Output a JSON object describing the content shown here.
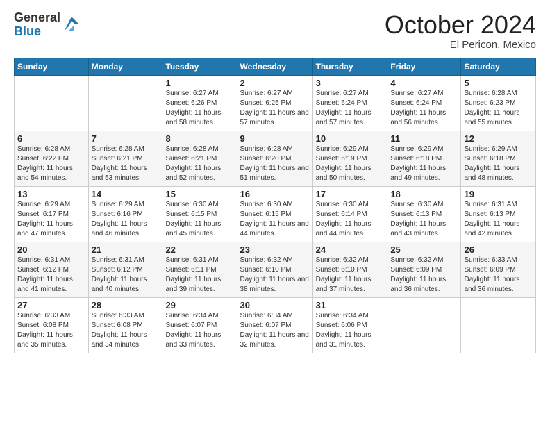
{
  "logo": {
    "general": "General",
    "blue": "Blue"
  },
  "header": {
    "month": "October 2024",
    "location": "El Pericon, Mexico"
  },
  "days_of_week": [
    "Sunday",
    "Monday",
    "Tuesday",
    "Wednesday",
    "Thursday",
    "Friday",
    "Saturday"
  ],
  "weeks": [
    [
      {
        "day": "",
        "info": ""
      },
      {
        "day": "",
        "info": ""
      },
      {
        "day": "1",
        "info": "Sunrise: 6:27 AM\nSunset: 6:26 PM\nDaylight: 11 hours and 58 minutes."
      },
      {
        "day": "2",
        "info": "Sunrise: 6:27 AM\nSunset: 6:25 PM\nDaylight: 11 hours and 57 minutes."
      },
      {
        "day": "3",
        "info": "Sunrise: 6:27 AM\nSunset: 6:24 PM\nDaylight: 11 hours and 57 minutes."
      },
      {
        "day": "4",
        "info": "Sunrise: 6:27 AM\nSunset: 6:24 PM\nDaylight: 11 hours and 56 minutes."
      },
      {
        "day": "5",
        "info": "Sunrise: 6:28 AM\nSunset: 6:23 PM\nDaylight: 11 hours and 55 minutes."
      }
    ],
    [
      {
        "day": "6",
        "info": "Sunrise: 6:28 AM\nSunset: 6:22 PM\nDaylight: 11 hours and 54 minutes."
      },
      {
        "day": "7",
        "info": "Sunrise: 6:28 AM\nSunset: 6:21 PM\nDaylight: 11 hours and 53 minutes."
      },
      {
        "day": "8",
        "info": "Sunrise: 6:28 AM\nSunset: 6:21 PM\nDaylight: 11 hours and 52 minutes."
      },
      {
        "day": "9",
        "info": "Sunrise: 6:28 AM\nSunset: 6:20 PM\nDaylight: 11 hours and 51 minutes."
      },
      {
        "day": "10",
        "info": "Sunrise: 6:29 AM\nSunset: 6:19 PM\nDaylight: 11 hours and 50 minutes."
      },
      {
        "day": "11",
        "info": "Sunrise: 6:29 AM\nSunset: 6:18 PM\nDaylight: 11 hours and 49 minutes."
      },
      {
        "day": "12",
        "info": "Sunrise: 6:29 AM\nSunset: 6:18 PM\nDaylight: 11 hours and 48 minutes."
      }
    ],
    [
      {
        "day": "13",
        "info": "Sunrise: 6:29 AM\nSunset: 6:17 PM\nDaylight: 11 hours and 47 minutes."
      },
      {
        "day": "14",
        "info": "Sunrise: 6:29 AM\nSunset: 6:16 PM\nDaylight: 11 hours and 46 minutes."
      },
      {
        "day": "15",
        "info": "Sunrise: 6:30 AM\nSunset: 6:15 PM\nDaylight: 11 hours and 45 minutes."
      },
      {
        "day": "16",
        "info": "Sunrise: 6:30 AM\nSunset: 6:15 PM\nDaylight: 11 hours and 44 minutes."
      },
      {
        "day": "17",
        "info": "Sunrise: 6:30 AM\nSunset: 6:14 PM\nDaylight: 11 hours and 44 minutes."
      },
      {
        "day": "18",
        "info": "Sunrise: 6:30 AM\nSunset: 6:13 PM\nDaylight: 11 hours and 43 minutes."
      },
      {
        "day": "19",
        "info": "Sunrise: 6:31 AM\nSunset: 6:13 PM\nDaylight: 11 hours and 42 minutes."
      }
    ],
    [
      {
        "day": "20",
        "info": "Sunrise: 6:31 AM\nSunset: 6:12 PM\nDaylight: 11 hours and 41 minutes."
      },
      {
        "day": "21",
        "info": "Sunrise: 6:31 AM\nSunset: 6:12 PM\nDaylight: 11 hours and 40 minutes."
      },
      {
        "day": "22",
        "info": "Sunrise: 6:31 AM\nSunset: 6:11 PM\nDaylight: 11 hours and 39 minutes."
      },
      {
        "day": "23",
        "info": "Sunrise: 6:32 AM\nSunset: 6:10 PM\nDaylight: 11 hours and 38 minutes."
      },
      {
        "day": "24",
        "info": "Sunrise: 6:32 AM\nSunset: 6:10 PM\nDaylight: 11 hours and 37 minutes."
      },
      {
        "day": "25",
        "info": "Sunrise: 6:32 AM\nSunset: 6:09 PM\nDaylight: 11 hours and 36 minutes."
      },
      {
        "day": "26",
        "info": "Sunrise: 6:33 AM\nSunset: 6:09 PM\nDaylight: 11 hours and 36 minutes."
      }
    ],
    [
      {
        "day": "27",
        "info": "Sunrise: 6:33 AM\nSunset: 6:08 PM\nDaylight: 11 hours and 35 minutes."
      },
      {
        "day": "28",
        "info": "Sunrise: 6:33 AM\nSunset: 6:08 PM\nDaylight: 11 hours and 34 minutes."
      },
      {
        "day": "29",
        "info": "Sunrise: 6:34 AM\nSunset: 6:07 PM\nDaylight: 11 hours and 33 minutes."
      },
      {
        "day": "30",
        "info": "Sunrise: 6:34 AM\nSunset: 6:07 PM\nDaylight: 11 hours and 32 minutes."
      },
      {
        "day": "31",
        "info": "Sunrise: 6:34 AM\nSunset: 6:06 PM\nDaylight: 11 hours and 31 minutes."
      },
      {
        "day": "",
        "info": ""
      },
      {
        "day": "",
        "info": ""
      }
    ]
  ]
}
